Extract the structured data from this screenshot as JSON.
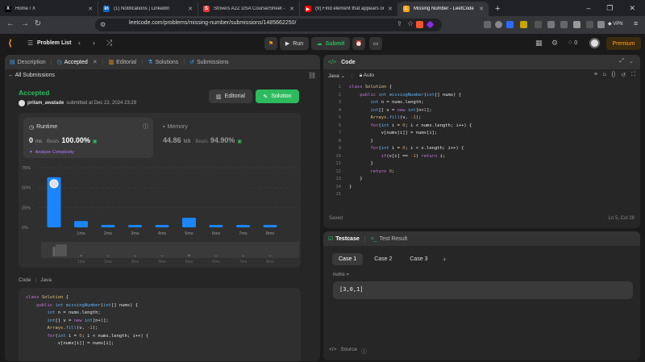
{
  "browser": {
    "tabs": [
      {
        "title": "Home / X",
        "icon": "x-logo-icon",
        "color": "#000000",
        "letter": "X"
      },
      {
        "title": "(1) Notifications | LinkedIn",
        "icon": "linkedin-icon",
        "color": "#0a66c2",
        "letter": "in"
      },
      {
        "title": "Strivers A2Z DSA Course/Sheet - Co",
        "icon": "striver-icon",
        "color": "#e53935",
        "letter": "S"
      },
      {
        "title": "(9) Find element that appears once",
        "icon": "youtube-icon",
        "color": "#ff0000",
        "letter": "▶"
      },
      {
        "title": "Missing Number - LeetCode",
        "icon": "leetcode-icon",
        "color": "#ffa116",
        "letter": "L"
      }
    ],
    "url": "leetcode.com/problems/missing-number/submissions/1485662250/",
    "vpn": "VPN"
  },
  "header": {
    "problem_list": "Problem List",
    "run": "Run",
    "submit": "Submit",
    "streak": "0",
    "premium": "Premium"
  },
  "left": {
    "tabs": {
      "description": "Description",
      "accepted": "Accepted",
      "editorial": "Editorial",
      "solutions": "Solutions",
      "submissions": "Submissions"
    },
    "back": "All Submissions",
    "status": "Accepted",
    "user": "pritam_awatade",
    "submitted": "submitted at Dec 22, 2024 23:29",
    "editorial_btn": "Editorial",
    "solution_btn": "Solution",
    "runtime_label": "Runtime",
    "runtime_value": "0",
    "runtime_unit": "ms",
    "beats_label": "Beats",
    "runtime_beats": "100.00%",
    "analyze": "Analyze Complexity",
    "memory_label": "Memory",
    "memory_value": "44.86",
    "memory_unit": "MB",
    "memory_beats": "94.90%",
    "code_lang_label": "Code",
    "code_lang": "Java",
    "code_lines": [
      "class Solution {",
      "    public int missingNumber(int[] nums) {",
      "        int n = nums.length;",
      "        int[] v = new int[n+1];",
      "        Arrays.fill(v, -1);",
      "        for(int i = 0; i < nums.length; i++) {",
      "            v[nums[i]] = nums[i];"
    ]
  },
  "chart_data": {
    "type": "bar",
    "categories": [
      "0ms",
      "1ms",
      "2ms",
      "3ms",
      "4ms",
      "5ms",
      "6ms",
      "7ms",
      "8ms"
    ],
    "tick_labels": [
      "",
      "1ms",
      "2ms",
      "3ms",
      "4ms",
      "5ms",
      "6ms",
      "7ms",
      "8ms"
    ],
    "values": [
      63,
      8,
      3,
      3,
      3,
      12,
      3,
      3,
      3
    ],
    "yticks": [
      "75%",
      "50%",
      "25%",
      "0%"
    ],
    "ylim": [
      0,
      75
    ],
    "highlight_index": 0,
    "color": "#1a85ff"
  },
  "editor": {
    "title": "Code",
    "language": "Java",
    "mode": "Auto",
    "lines": [
      "class Solution {",
      "    public int missingNumber(int[] nums) {",
      "        int n = nums.length;",
      "        int[] v = new int[n+1];",
      "        Arrays.fill(v, -1);",
      "        for(int i = 0; i < nums.length; i++) {",
      "            v[nums[i]] = nums[i];",
      "        }",
      "        for(int i = 0; i < v.length; i++) {",
      "            if(v[i] == -1) return i;",
      "        }",
      "        return 0;",
      "    }",
      "}",
      ""
    ],
    "saved": "Saved",
    "cursor": "Ln 5, Col 28"
  },
  "testcase": {
    "tab_testcase": "Testcase",
    "tab_result": "Test Result",
    "cases": [
      "Case 1",
      "Case 2",
      "Case 3"
    ],
    "param": "nums =",
    "value": "[3,0,1]",
    "source": "Source"
  }
}
